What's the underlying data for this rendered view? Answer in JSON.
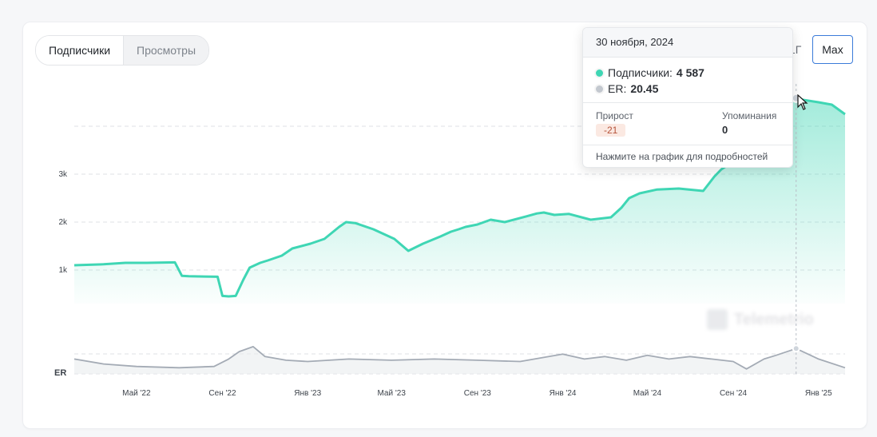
{
  "toggle": {
    "subscribers": "Подписчики",
    "views": "Просмотры"
  },
  "ranges": {
    "year": "1Г",
    "max": "Max"
  },
  "er_label": "ER",
  "watermark": "Telemetrio",
  "tooltip": {
    "date": "30 ноября, 2024",
    "subscribers_label": "Подписчики:",
    "subscribers_value": "4 587",
    "er_label": "ER:",
    "er_value": "20.45",
    "growth_label": "Прирост",
    "growth_value": "-21",
    "mentions_label": "Упоминания",
    "mentions_value": "0",
    "footer": "Нажмите на график для подробностей"
  },
  "colors": {
    "subscribers_line": "#3fd6b4",
    "subscribers_fill": "#3fd6b4",
    "er_line": "#a4abb5",
    "grid": "#dfe2e6"
  },
  "chart_data": {
    "type": "area",
    "x_ticks": [
      "Май '22",
      "Сен '22",
      "Янв '23",
      "Май '23",
      "Сен '23",
      "Янв '24",
      "Май '24",
      "Сен '24",
      "Янв '25"
    ],
    "y_ticks": [
      "1k",
      "2k",
      "3k"
    ],
    "series": [
      {
        "name": "Подписчики",
        "x": [
          "2022-02-01",
          "2022-03-15",
          "2022-04-15",
          "2022-05-15",
          "2022-06-25",
          "2022-07-05",
          "2022-07-15",
          "2022-08-25",
          "2022-09-01",
          "2022-09-10",
          "2022-09-20",
          "2022-10-01",
          "2022-10-10",
          "2022-10-25",
          "2022-11-05",
          "2022-11-15",
          "2022-11-25",
          "2022-12-10",
          "2023-01-05",
          "2023-01-25",
          "2023-02-15",
          "2023-02-25",
          "2023-03-10",
          "2023-04-05",
          "2023-04-20",
          "2023-05-05",
          "2023-05-25",
          "2023-06-15",
          "2023-07-10",
          "2023-07-25",
          "2023-08-05",
          "2023-08-15",
          "2023-09-01",
          "2023-09-20",
          "2023-10-10",
          "2023-11-10",
          "2023-11-25",
          "2023-12-05",
          "2023-12-20",
          "2024-01-10",
          "2024-02-10",
          "2024-03-10",
          "2024-03-25",
          "2024-04-05",
          "2024-04-20",
          "2024-05-15",
          "2024-06-15",
          "2024-07-20",
          "2024-08-05",
          "2024-08-15",
          "2024-09-10",
          "2024-10-10",
          "2024-10-25",
          "2024-11-10",
          "2024-11-30",
          "2024-12-10",
          "2025-01-01",
          "2025-01-20",
          "2025-02-08"
        ],
        "values": [
          1100,
          1120,
          1150,
          1150,
          1160,
          880,
          870,
          860,
          460,
          450,
          460,
          800,
          1050,
          1150,
          1200,
          1250,
          1300,
          1450,
          1550,
          1650,
          1900,
          2000,
          1980,
          1850,
          1750,
          1650,
          1400,
          1550,
          1700,
          1800,
          1850,
          1900,
          1950,
          2050,
          2000,
          2120,
          2180,
          2200,
          2150,
          2170,
          2050,
          2100,
          2300,
          2500,
          2600,
          2680,
          2700,
          2650,
          2950,
          3100,
          3350,
          3500,
          4100,
          4400,
          4587,
          4550,
          4500,
          4450,
          4250
        ]
      },
      {
        "name": "ER",
        "x": [
          "2022-02-01",
          "2022-03-15",
          "2022-05-01",
          "2022-07-01",
          "2022-08-20",
          "2022-09-10",
          "2022-09-25",
          "2022-10-15",
          "2022-11-01",
          "2022-12-01",
          "2023-01-01",
          "2023-03-01",
          "2023-05-01",
          "2023-07-01",
          "2023-09-01",
          "2023-11-01",
          "2024-01-01",
          "2024-02-01",
          "2024-03-01",
          "2024-04-01",
          "2024-05-01",
          "2024-06-01",
          "2024-07-01",
          "2024-08-01",
          "2024-09-01",
          "2024-09-20",
          "2024-10-15",
          "2024-11-01",
          "2024-11-30",
          "2025-01-01",
          "2025-02-08"
        ],
        "values": [
          12,
          8,
          6,
          5,
          6,
          12,
          18,
          22,
          14,
          11,
          10,
          12,
          11,
          12,
          11,
          10,
          16,
          12,
          14,
          11,
          15,
          12,
          14,
          12,
          10,
          4,
          12,
          15,
          20.45,
          12,
          5
        ]
      }
    ]
  }
}
